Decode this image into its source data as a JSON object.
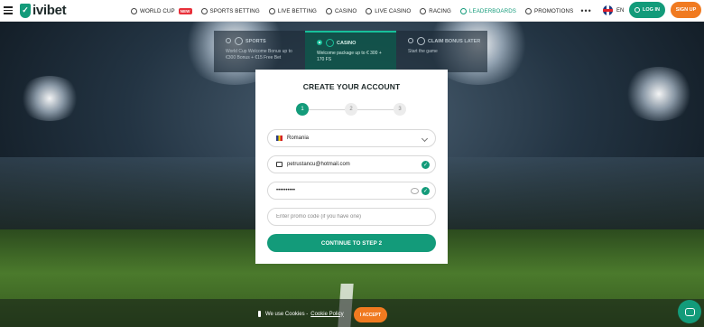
{
  "brand": {
    "logo_text": "ivibet"
  },
  "nav": {
    "items": [
      {
        "label": "WORLD CUP",
        "icon": "trophy-icon",
        "badge": "NEW"
      },
      {
        "label": "SPORTS BETTING",
        "icon": "soccer-ball-icon"
      },
      {
        "label": "LIVE BETTING",
        "icon": "live-icon"
      },
      {
        "label": "CASINO",
        "icon": "casino-chip-icon"
      },
      {
        "label": "LIVE CASINO",
        "icon": "live-casino-icon"
      },
      {
        "label": "RACING",
        "icon": "horse-icon"
      },
      {
        "label": "LEADERBOARDS",
        "icon": "leaderboard-icon",
        "active": true
      },
      {
        "label": "PROMOTIONS",
        "icon": "gift-icon"
      }
    ],
    "more": "•••"
  },
  "header": {
    "lang": "EN",
    "login_label": "LOG IN",
    "signup_label": "SIGN UP"
  },
  "bonus": {
    "tabs": [
      {
        "title": "SPORTS",
        "desc": "World Cup Welcome Bonus up to €300 Bonus + €15 Free Bet"
      },
      {
        "title": "CASINO",
        "desc": "Welcome package up to € 300 + 170 FS",
        "selected": true
      },
      {
        "title": "CLAIM BONUS LATER",
        "desc": "Start the game"
      }
    ]
  },
  "signup": {
    "title": "CREATE YOUR ACCOUNT",
    "steps": [
      "1",
      "2",
      "3"
    ],
    "active_step": 1,
    "country": "Romania",
    "email": "petrustancu@hotmail.com",
    "password": "••••••••••",
    "promo_placeholder": "Enter promo code (if you have one)",
    "continue_label": "CONTINUE TO STEP 2"
  },
  "cookie": {
    "text": "We use Cookies -",
    "link": "Cookie Policy",
    "accept_label": "I ACCEPT"
  },
  "colors": {
    "brand_green": "#139b7a",
    "accent_orange": "#f07a20"
  }
}
